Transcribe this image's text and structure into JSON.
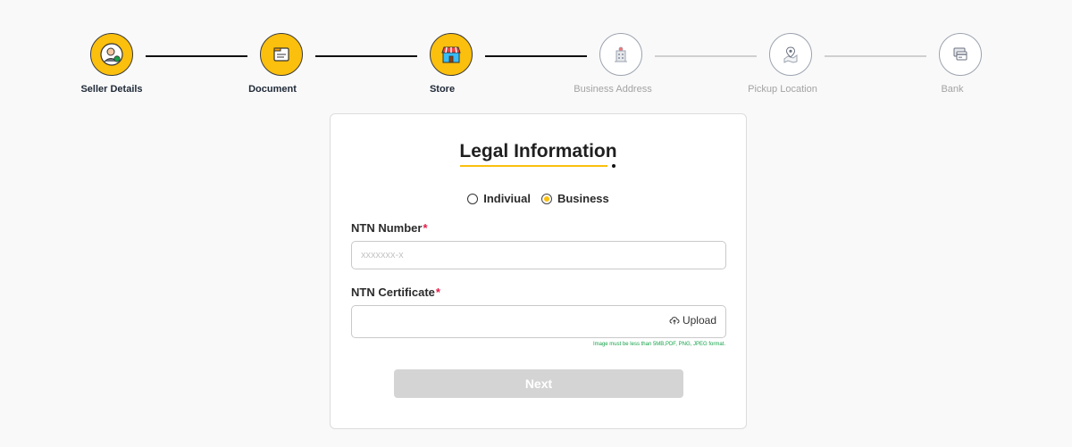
{
  "stepper": {
    "steps": [
      {
        "label": "Seller Details",
        "icon": "seller-avatar-icon",
        "state": "done"
      },
      {
        "label": "Document",
        "icon": "document-folder-icon",
        "state": "done"
      },
      {
        "label": "Store",
        "icon": "store-front-icon",
        "state": "done"
      },
      {
        "label": "Business Address",
        "icon": "building-icon",
        "state": "todo"
      },
      {
        "label": "Pickup Location",
        "icon": "map-pin-icon",
        "state": "todo"
      },
      {
        "label": "Bank",
        "icon": "bank-card-icon",
        "state": "todo"
      }
    ]
  },
  "form": {
    "title": "Legal Information",
    "entity_type": {
      "options": [
        "Indiviual",
        "Business"
      ],
      "selected": "Business"
    },
    "ntn_number": {
      "label": "NTN Number",
      "required_mark": "*",
      "placeholder": "xxxxxxx-x",
      "value": ""
    },
    "ntn_certificate": {
      "label": "NTN Certificate",
      "required_mark": "*",
      "upload_label": "Upload",
      "hint": "Image must be less than 5MB,PDF, PNG, JPEG format."
    },
    "next_label": "Next"
  },
  "colors": {
    "accent": "#fbbf0d",
    "done_line": "#111111",
    "todo_line": "#cfcfcf",
    "hint": "#16a34a",
    "required": "#e11d48",
    "disabled_button": "#d4d4d4"
  }
}
